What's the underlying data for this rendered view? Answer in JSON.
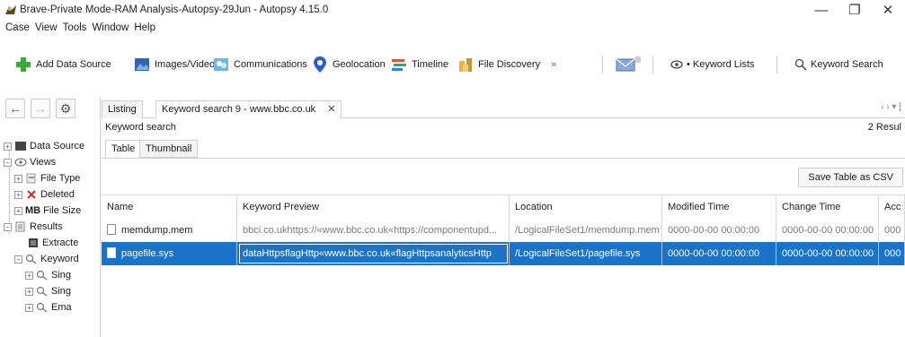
{
  "window": {
    "title": "Brave-Private Mode-RAM Analysis-Autopsy-29Jun - Autopsy 4.15.0",
    "minimize": "—",
    "maximize": "❐",
    "close": "✕"
  },
  "menu": [
    "Case",
    "View",
    "Tools",
    "Window",
    "Help"
  ],
  "toolbar": {
    "add_data_source": "Add Data Source",
    "images_videos": "Images/Videos",
    "communications": "Communications",
    "geolocation": "Geolocation",
    "timeline": "Timeline",
    "file_discovery": "File Discovery",
    "more_glyph": "»",
    "keyword_lists": "• Keyword Lists",
    "keyword_search": "Keyword Search"
  },
  "tree": {
    "nav_back": "←",
    "nav_forward": "→",
    "nav_settings": "⚙",
    "items": [
      {
        "label": "Data Source"
      },
      {
        "label": "Views"
      },
      {
        "label": "File Type"
      },
      {
        "label": "Deleted"
      },
      {
        "label": "File Size",
        "prefix": "MB"
      },
      {
        "label": "Results"
      },
      {
        "label": "Extracte"
      },
      {
        "label": "Keyword"
      },
      {
        "label": "Sing"
      },
      {
        "label": "Sing"
      },
      {
        "label": "Ema"
      }
    ]
  },
  "tabs": {
    "listing": "Listing",
    "active": "Keyword search 9 - www.bbc.co.uk",
    "active_close": "✕",
    "nav": "‹  ›  ▾ ["
  },
  "panel": {
    "title": "Keyword search",
    "count": "2 Resul",
    "subtabs": [
      "Table",
      "Thumbnail"
    ],
    "save_csv": "Save Table as CSV"
  },
  "table": {
    "columns": [
      "Name",
      "Keyword Preview",
      "Location",
      "Modified Time",
      "Change Time",
      "Acc"
    ],
    "rows": [
      {
        "name": "memdump.mem",
        "preview": "bbci.co.ukhttps://«www.bbc.co.uk«https://componentupd...",
        "location": "/LogicalFileSet1/memdump.mem",
        "modified": "0000-00-00 00:00:00",
        "change": "0000-00-00 00:00:00",
        "access": "000",
        "selected": false
      },
      {
        "name": "pagefile.sys",
        "preview": "dataHttpsflagHttp«www.bbc.co.uk«flagHttpsanalyticsHttp",
        "location": "/LogicalFileSet1/pagefile.sys",
        "modified": "0000-00-00 00:00:00",
        "change": "0000-00-00 00:00:00",
        "access": "000",
        "selected": true
      }
    ]
  },
  "colors": {
    "selection": "#1a73c9",
    "accent_plus": "#3aa935"
  }
}
